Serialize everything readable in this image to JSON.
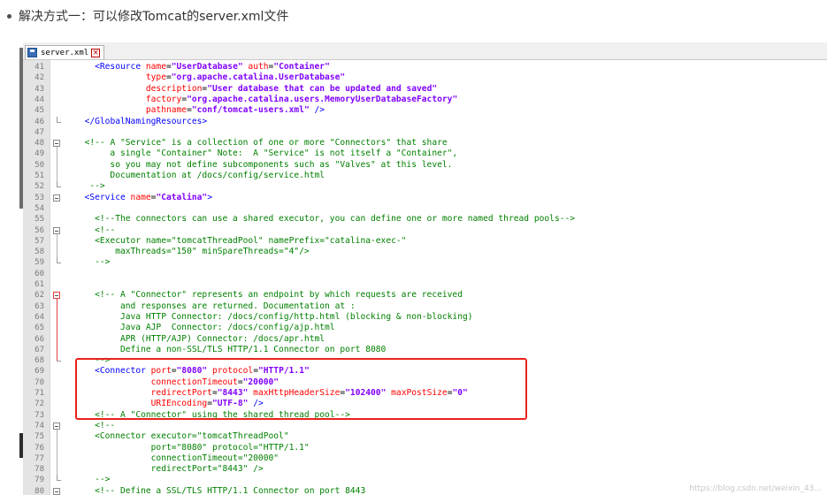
{
  "heading": {
    "text": "解决方式一：可以修改Tomcat的server.xml文件"
  },
  "editor": {
    "tab_label": "server.xml",
    "close_glyph": "×"
  },
  "watermark": "https://blog.csdn.net/weixin_43...",
  "code_lines": [
    {
      "n": "41",
      "fold": "",
      "tokens": [
        [
          "tk-bk",
          "    "
        ],
        [
          "tk-bl",
          "<Resource "
        ],
        [
          "tk-rd",
          "name"
        ],
        [
          "tk-bk",
          "="
        ],
        [
          "tk-pp",
          "\"UserDatabase\""
        ],
        [
          "tk-bk",
          " "
        ],
        [
          "tk-rd",
          "auth"
        ],
        [
          "tk-bk",
          "="
        ],
        [
          "tk-pp",
          "\"Container\""
        ]
      ]
    },
    {
      "n": "42",
      "fold": "",
      "tokens": [
        [
          "tk-bk",
          "              "
        ],
        [
          "tk-rd",
          "type"
        ],
        [
          "tk-bk",
          "="
        ],
        [
          "tk-pp",
          "\"org.apache.catalina.UserDatabase\""
        ]
      ]
    },
    {
      "n": "43",
      "fold": "",
      "tokens": [
        [
          "tk-bk",
          "              "
        ],
        [
          "tk-rd",
          "description"
        ],
        [
          "tk-bk",
          "="
        ],
        [
          "tk-pp",
          "\"User database that can be updated and saved\""
        ]
      ]
    },
    {
      "n": "44",
      "fold": "",
      "tokens": [
        [
          "tk-bk",
          "              "
        ],
        [
          "tk-rd",
          "factory"
        ],
        [
          "tk-bk",
          "="
        ],
        [
          "tk-pp",
          "\"org.apache.catalina.users.MemoryUserDatabaseFactory\""
        ]
      ]
    },
    {
      "n": "45",
      "fold": "",
      "tokens": [
        [
          "tk-bk",
          "              "
        ],
        [
          "tk-rd",
          "pathname"
        ],
        [
          "tk-bk",
          "="
        ],
        [
          "tk-pp",
          "\"conf/tomcat-users.xml\""
        ],
        [
          "tk-bk",
          " "
        ],
        [
          "tk-bl",
          "/>"
        ]
      ]
    },
    {
      "n": "46",
      "fold": "end",
      "tokens": [
        [
          "tk-bk",
          "  "
        ],
        [
          "tk-bl",
          "</GlobalNamingResources>"
        ]
      ]
    },
    {
      "n": "47",
      "fold": "",
      "tokens": []
    },
    {
      "n": "48",
      "fold": "box",
      "tokens": [
        [
          "tk-bk",
          "  "
        ],
        [
          "tk-gr",
          "<!-- A \"Service\" is a collection of one or more \"Connectors\" that share"
        ]
      ]
    },
    {
      "n": "49",
      "fold": "",
      "tokens": [
        [
          "tk-gr",
          "       a single \"Container\" Note:  A \"Service\" is not itself a \"Container\","
        ]
      ]
    },
    {
      "n": "50",
      "fold": "",
      "tokens": [
        [
          "tk-gr",
          "       so you may not define subcomponents such as \"Valves\" at this level."
        ]
      ]
    },
    {
      "n": "51",
      "fold": "",
      "tokens": [
        [
          "tk-gr",
          "       Documentation at /docs/config/service.html"
        ]
      ]
    },
    {
      "n": "52",
      "fold": "end",
      "tokens": [
        [
          "tk-gr",
          "   -->"
        ]
      ]
    },
    {
      "n": "53",
      "fold": "box",
      "tokens": [
        [
          "tk-bk",
          "  "
        ],
        [
          "tk-bl",
          "<Service "
        ],
        [
          "tk-rd",
          "name"
        ],
        [
          "tk-bk",
          "="
        ],
        [
          "tk-pp",
          "\"Catalina\""
        ],
        [
          "tk-bl",
          ">"
        ]
      ]
    },
    {
      "n": "54",
      "fold": "",
      "tokens": []
    },
    {
      "n": "55",
      "fold": "",
      "tokens": [
        [
          "tk-bk",
          "    "
        ],
        [
          "tk-gr",
          "<!--The connectors can use a shared executor, you can define one or more named thread pools-->"
        ]
      ]
    },
    {
      "n": "56",
      "fold": "box",
      "tokens": [
        [
          "tk-bk",
          "    "
        ],
        [
          "tk-gr",
          "<!--"
        ]
      ]
    },
    {
      "n": "57",
      "fold": "",
      "tokens": [
        [
          "tk-gr",
          "    <Executor name=\"tomcatThreadPool\" namePrefix=\"catalina-exec-\""
        ]
      ]
    },
    {
      "n": "58",
      "fold": "",
      "tokens": [
        [
          "tk-gr",
          "        maxThreads=\"150\" minSpareThreads=\"4\"/>"
        ]
      ]
    },
    {
      "n": "59",
      "fold": "end",
      "tokens": [
        [
          "tk-gr",
          "    -->"
        ]
      ]
    },
    {
      "n": "60",
      "fold": "",
      "tokens": []
    },
    {
      "n": "61",
      "fold": "",
      "tokens": []
    },
    {
      "n": "62",
      "fold": "boxred",
      "tokens": [
        [
          "tk-bk",
          "    "
        ],
        [
          "tk-gr",
          "<!-- A \"Connector\" represents an endpoint by which requests are received"
        ]
      ]
    },
    {
      "n": "63",
      "fold": "",
      "tokens": [
        [
          "tk-gr",
          "         and responses are returned. Documentation at :"
        ]
      ]
    },
    {
      "n": "64",
      "fold": "",
      "tokens": [
        [
          "tk-gr",
          "         Java HTTP Connector: /docs/config/http.html (blocking & non-blocking)"
        ]
      ]
    },
    {
      "n": "65",
      "fold": "",
      "tokens": [
        [
          "tk-gr",
          "         Java AJP  Connector: /docs/config/ajp.html"
        ]
      ]
    },
    {
      "n": "66",
      "fold": "",
      "tokens": [
        [
          "tk-gr",
          "         APR (HTTP/AJP) Connector: /docs/apr.html"
        ]
      ]
    },
    {
      "n": "67",
      "fold": "",
      "tokens": [
        [
          "tk-gr",
          "         Define a non-SSL/TLS HTTP/1.1 Connector on port 8080"
        ]
      ]
    },
    {
      "n": "68",
      "fold": "endred",
      "tokens": [
        [
          "tk-gr",
          "    -->"
        ]
      ]
    },
    {
      "n": "69",
      "fold": "",
      "tokens": [
        [
          "tk-bk",
          "    "
        ],
        [
          "tk-bl",
          "<Connector "
        ],
        [
          "tk-rd",
          "port"
        ],
        [
          "tk-bk",
          "="
        ],
        [
          "tk-pp",
          "\"8080\""
        ],
        [
          "tk-bk",
          " "
        ],
        [
          "tk-rd",
          "protocol"
        ],
        [
          "tk-bk",
          "="
        ],
        [
          "tk-pp",
          "\"HTTP/1.1\""
        ]
      ]
    },
    {
      "n": "70",
      "fold": "",
      "tokens": [
        [
          "tk-bk",
          "               "
        ],
        [
          "tk-rd",
          "connectionTimeout"
        ],
        [
          "tk-bk",
          "="
        ],
        [
          "tk-pp",
          "\"20000\""
        ]
      ]
    },
    {
      "n": "71",
      "fold": "",
      "tokens": [
        [
          "tk-bk",
          "               "
        ],
        [
          "tk-rd",
          "redirectPort"
        ],
        [
          "tk-bk",
          "="
        ],
        [
          "tk-pp",
          "\"8443\""
        ],
        [
          "tk-bk",
          " "
        ],
        [
          "tk-rd",
          "maxHttpHeaderSize"
        ],
        [
          "tk-bk",
          "="
        ],
        [
          "tk-pp",
          "\"102400\""
        ],
        [
          "tk-bk",
          " "
        ],
        [
          "tk-rd",
          "maxPostSize"
        ],
        [
          "tk-bk",
          "="
        ],
        [
          "tk-pp",
          "\"0\""
        ]
      ]
    },
    {
      "n": "72",
      "fold": "",
      "tokens": [
        [
          "tk-bk",
          "               "
        ],
        [
          "tk-rd",
          "URIEncoding"
        ],
        [
          "tk-bk",
          "="
        ],
        [
          "tk-pp",
          "\"UTF-8\""
        ],
        [
          "tk-bk",
          " "
        ],
        [
          "tk-bl",
          "/>"
        ]
      ]
    },
    {
      "n": "73",
      "fold": "",
      "tokens": [
        [
          "tk-bk",
          "    "
        ],
        [
          "tk-gr",
          "<!-- A \"Connector\" using the shared thread pool-->"
        ]
      ]
    },
    {
      "n": "74",
      "fold": "box",
      "tokens": [
        [
          "tk-bk",
          "    "
        ],
        [
          "tk-gr",
          "<!--"
        ]
      ]
    },
    {
      "n": "75",
      "fold": "",
      "tokens": [
        [
          "tk-gr",
          "    <Connector executor=\"tomcatThreadPool\""
        ]
      ]
    },
    {
      "n": "76",
      "fold": "",
      "tokens": [
        [
          "tk-gr",
          "               port=\"8080\" protocol=\"HTTP/1.1\""
        ]
      ]
    },
    {
      "n": "77",
      "fold": "",
      "tokens": [
        [
          "tk-gr",
          "               connectionTimeout=\"20000\""
        ]
      ]
    },
    {
      "n": "78",
      "fold": "",
      "tokens": [
        [
          "tk-gr",
          "               redirectPort=\"8443\" />"
        ]
      ]
    },
    {
      "n": "79",
      "fold": "end",
      "tokens": [
        [
          "tk-gr",
          "    -->"
        ]
      ]
    },
    {
      "n": "80",
      "fold": "box",
      "tokens": [
        [
          "tk-bk",
          "    "
        ],
        [
          "tk-gr",
          "<!-- Define a SSL/TLS HTTP/1.1 Connector on port 8443"
        ]
      ]
    }
  ]
}
